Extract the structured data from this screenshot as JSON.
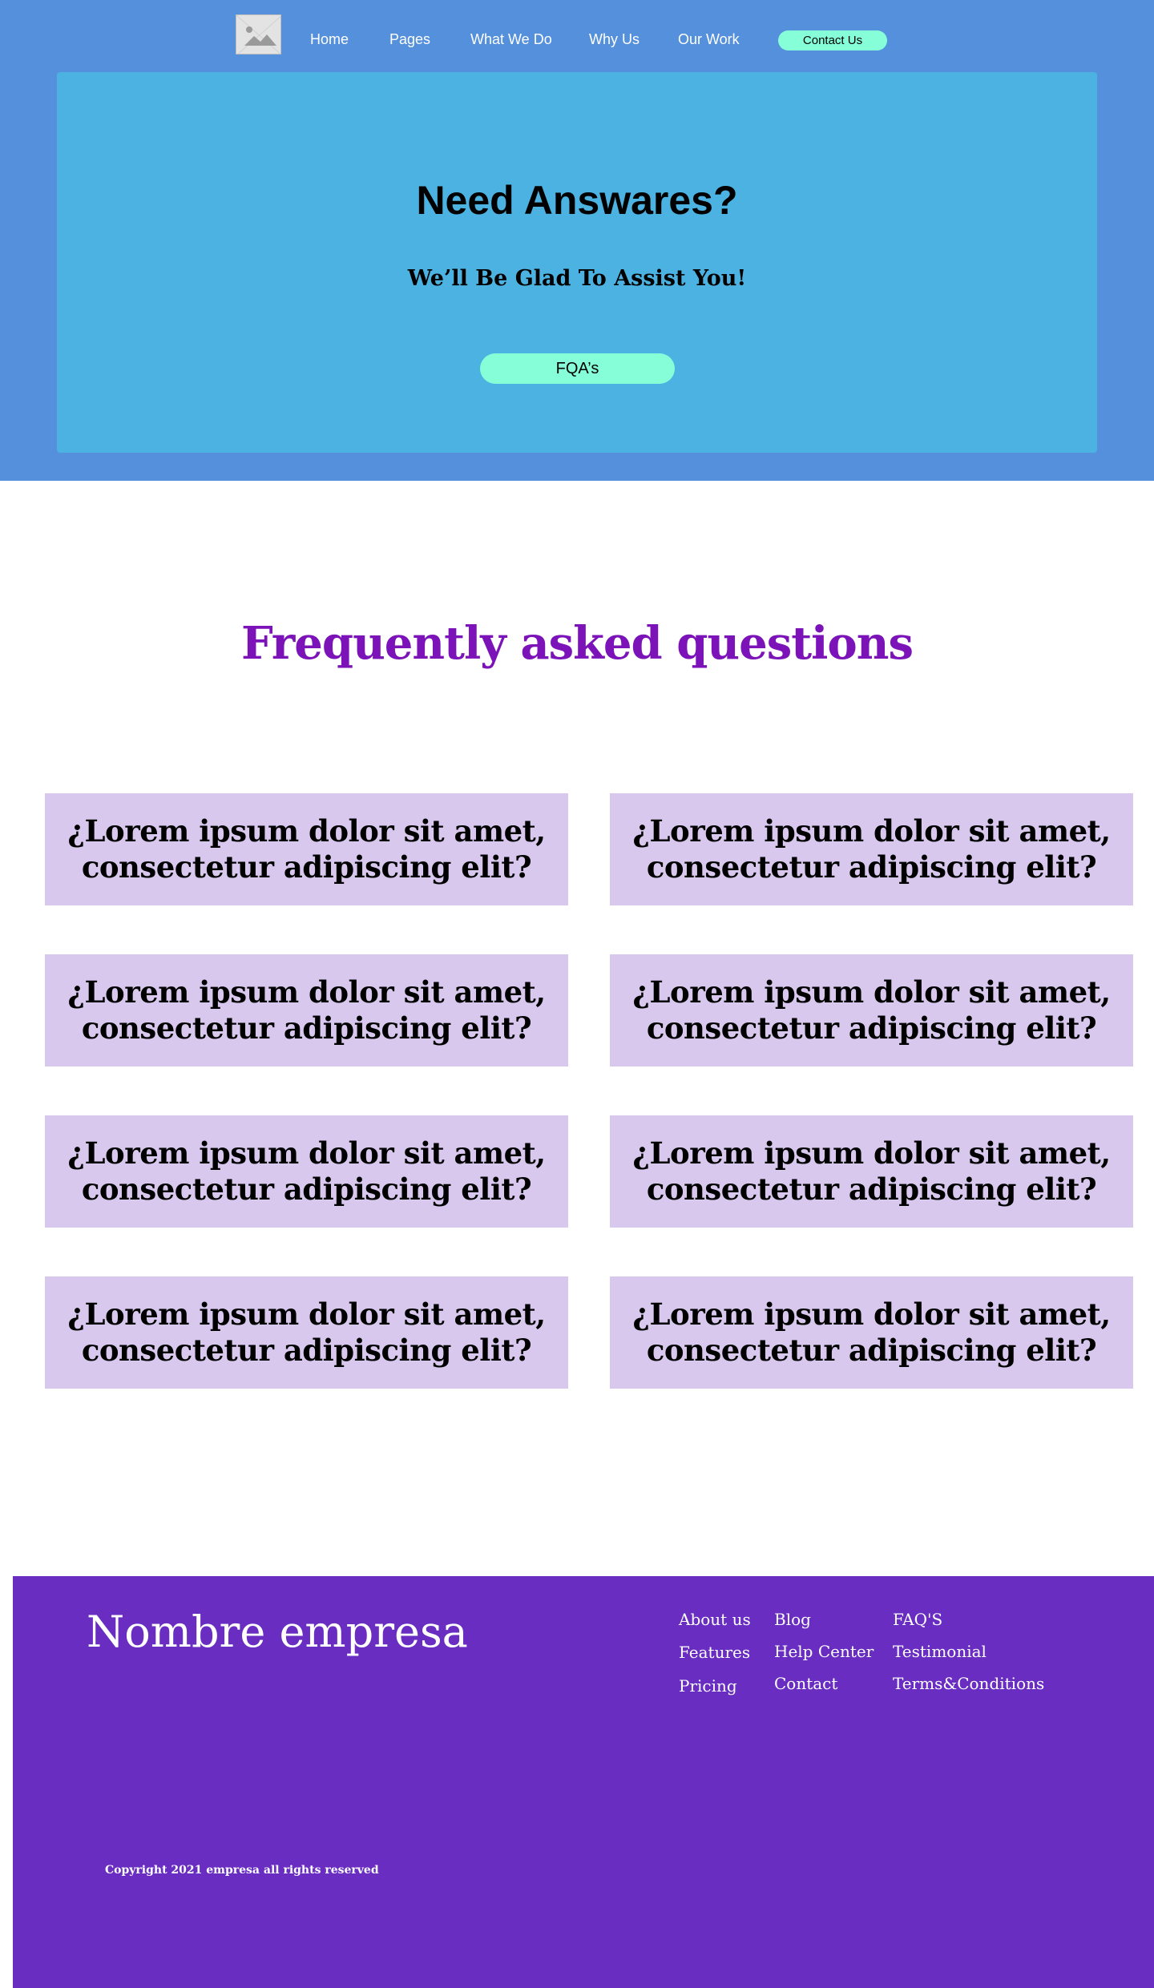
{
  "nav": {
    "logo_icon": "image-placeholder-icon",
    "links": [
      "Home",
      "Pages",
      "What We Do",
      "Why Us",
      "Our Work"
    ],
    "contact_label": "Contact Us"
  },
  "hero": {
    "title": "Need Answares?",
    "subtitle": "We’ll Be Glad To Assist You!",
    "button_label": "FQA’s"
  },
  "faq": {
    "heading": "Frequently asked questions",
    "questions": [
      "¿Lorem ipsum dolor sit amet, consectetur adipiscing elit?",
      "¿Lorem ipsum dolor sit amet, consectetur adipiscing elit?",
      "¿Lorem ipsum dolor sit amet, consectetur adipiscing elit?",
      "¿Lorem ipsum dolor sit amet, consectetur adipiscing elit?",
      "¿Lorem ipsum dolor sit amet, consectetur adipiscing elit?",
      "¿Lorem ipsum dolor sit amet, consectetur adipiscing elit?",
      "¿Lorem ipsum dolor sit amet, consectetur adipiscing elit?",
      "¿Lorem ipsum dolor sit amet, consectetur adipiscing elit?"
    ]
  },
  "footer": {
    "brand": "Nombre empresa",
    "col1": [
      "About us",
      "Features",
      "Pricing"
    ],
    "col2": [
      "Blog",
      "Help Center",
      "Contact"
    ],
    "col3": [
      "FAQ'S",
      "Testimonial",
      "Terms&Conditions"
    ],
    "copyright": "Copyright 2021 empresa all rights reserved"
  },
  "colors": {
    "hero_bg": "#5590dc",
    "hero_card": "#4bb2e1",
    "accent_button": "#86ffd9",
    "faq_heading": "#7b13b8",
    "faq_card": "#d8c8ee",
    "footer_bg": "#692dc1"
  }
}
